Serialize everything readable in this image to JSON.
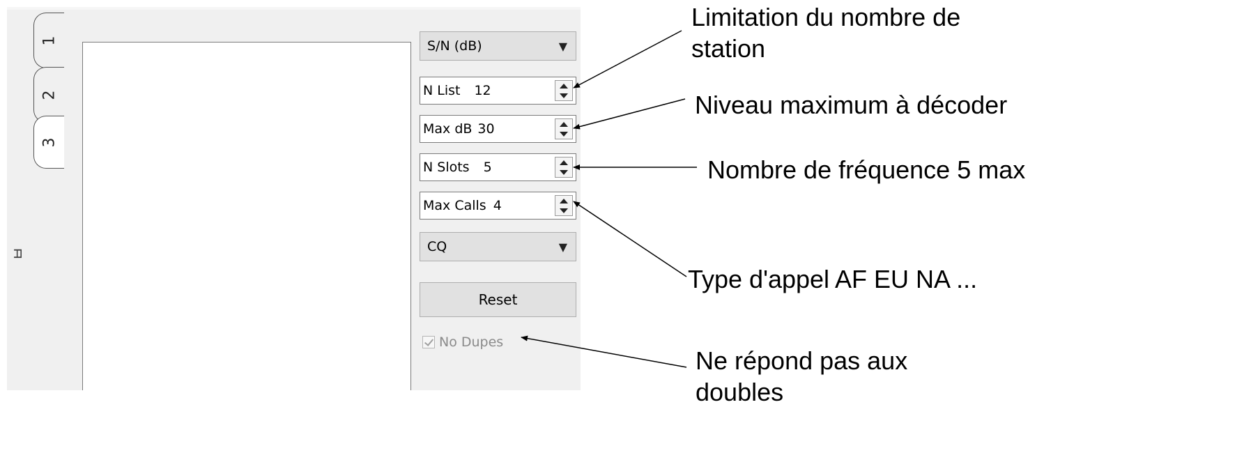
{
  "tabs": [
    {
      "label": "1"
    },
    {
      "label": "2"
    },
    {
      "label": "3"
    }
  ],
  "side_glyph": "ㅂ",
  "controls": {
    "sort_combo": {
      "value": "S/N (dB)",
      "icon": "chevron-down-icon"
    },
    "n_list": {
      "label": "N List",
      "value": "12"
    },
    "max_db": {
      "label": "Max dB",
      "value": "30"
    },
    "n_slots": {
      "label": "N Slots",
      "value": "5"
    },
    "max_calls": {
      "label": "Max Calls",
      "value": "4"
    },
    "call_type_combo": {
      "value": "CQ",
      "icon": "chevron-down-icon"
    },
    "reset_label": "Reset",
    "no_dupes": {
      "label": "No Dupes",
      "checked": true
    }
  },
  "annotations": {
    "limitation_line1": "Limitation du nombre de",
    "limitation_line2": "station",
    "niveau": "Niveau maximum  à décoder",
    "nombre": "Nombre de fréquence  5 max",
    "type": "Type d'appel  AF EU NA ...",
    "ne_repond_line1": "Ne répond pas aux",
    "ne_repond_line2": "doubles"
  }
}
